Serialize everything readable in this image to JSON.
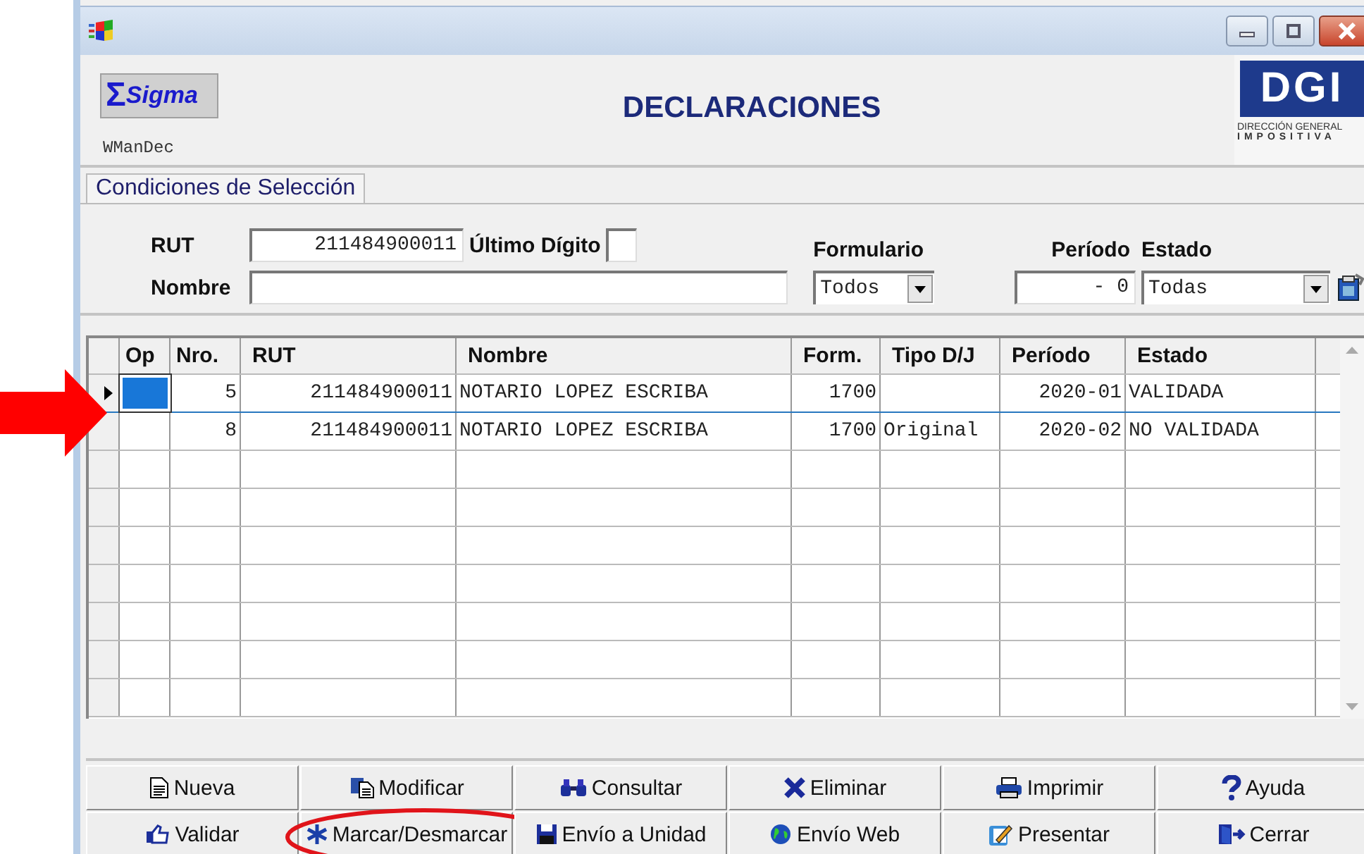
{
  "app": {
    "logo_text": "Sigma",
    "logo_symbol": "Σ",
    "module": "WManDec",
    "heading": "DECLARACIONES",
    "brand": {
      "letters": "DGI",
      "line1": "DIRECCIÓN GENERAL",
      "line2": "IMPOSITIVA"
    }
  },
  "tabs": [
    {
      "label": "Condiciones de Selección",
      "selected": true
    }
  ],
  "filters": {
    "rut": {
      "label": "RUT",
      "value": "211484900011"
    },
    "ultimo_digito": {
      "label": "Último Dígito"
    },
    "nombre": {
      "label": "Nombre"
    },
    "formulario": {
      "label": "Formulario",
      "value": "Todos"
    },
    "periodo": {
      "label": "Período",
      "value": "- 0"
    },
    "estado": {
      "label": "Estado",
      "value": "Todas"
    }
  },
  "grid": {
    "columns": [
      "Op",
      "Nro.",
      "RUT",
      "Nombre",
      "Form.",
      "Tipo D/J",
      "Período",
      "Estado"
    ],
    "rows": [
      {
        "selected": true,
        "cells": [
          "",
          "5",
          "211484900011",
          "NOTARIO LOPEZ ESCRIBA",
          "1700",
          "",
          "2020-01",
          "VALIDADA"
        ]
      },
      {
        "selected": false,
        "cells": [
          "",
          "8",
          "211484900011",
          "NOTARIO LOPEZ ESCRIBA",
          "1700",
          "Original",
          "2020-02",
          "NO VALIDADA"
        ]
      }
    ]
  },
  "buttons": [
    {
      "label": "Nueva",
      "kind": "new"
    },
    {
      "label": "Modificar",
      "kind": "edit"
    },
    {
      "label": "Consultar",
      "kind": "find"
    },
    {
      "label": "Eliminar",
      "kind": "delete"
    },
    {
      "label": "Imprimir",
      "kind": "print"
    },
    {
      "label": "Ayuda",
      "kind": "help"
    },
    {
      "label": "Validar",
      "kind": "approve"
    },
    {
      "label": "Marcar/Desmarcar",
      "kind": "mark",
      "highlighted": true
    },
    {
      "label": "Envío a Unidad",
      "kind": "save"
    },
    {
      "label": "Envío Web",
      "kind": "web"
    },
    {
      "label": "Presentar",
      "kind": "submit"
    },
    {
      "label": "Cerrar",
      "kind": "exit"
    }
  ]
}
